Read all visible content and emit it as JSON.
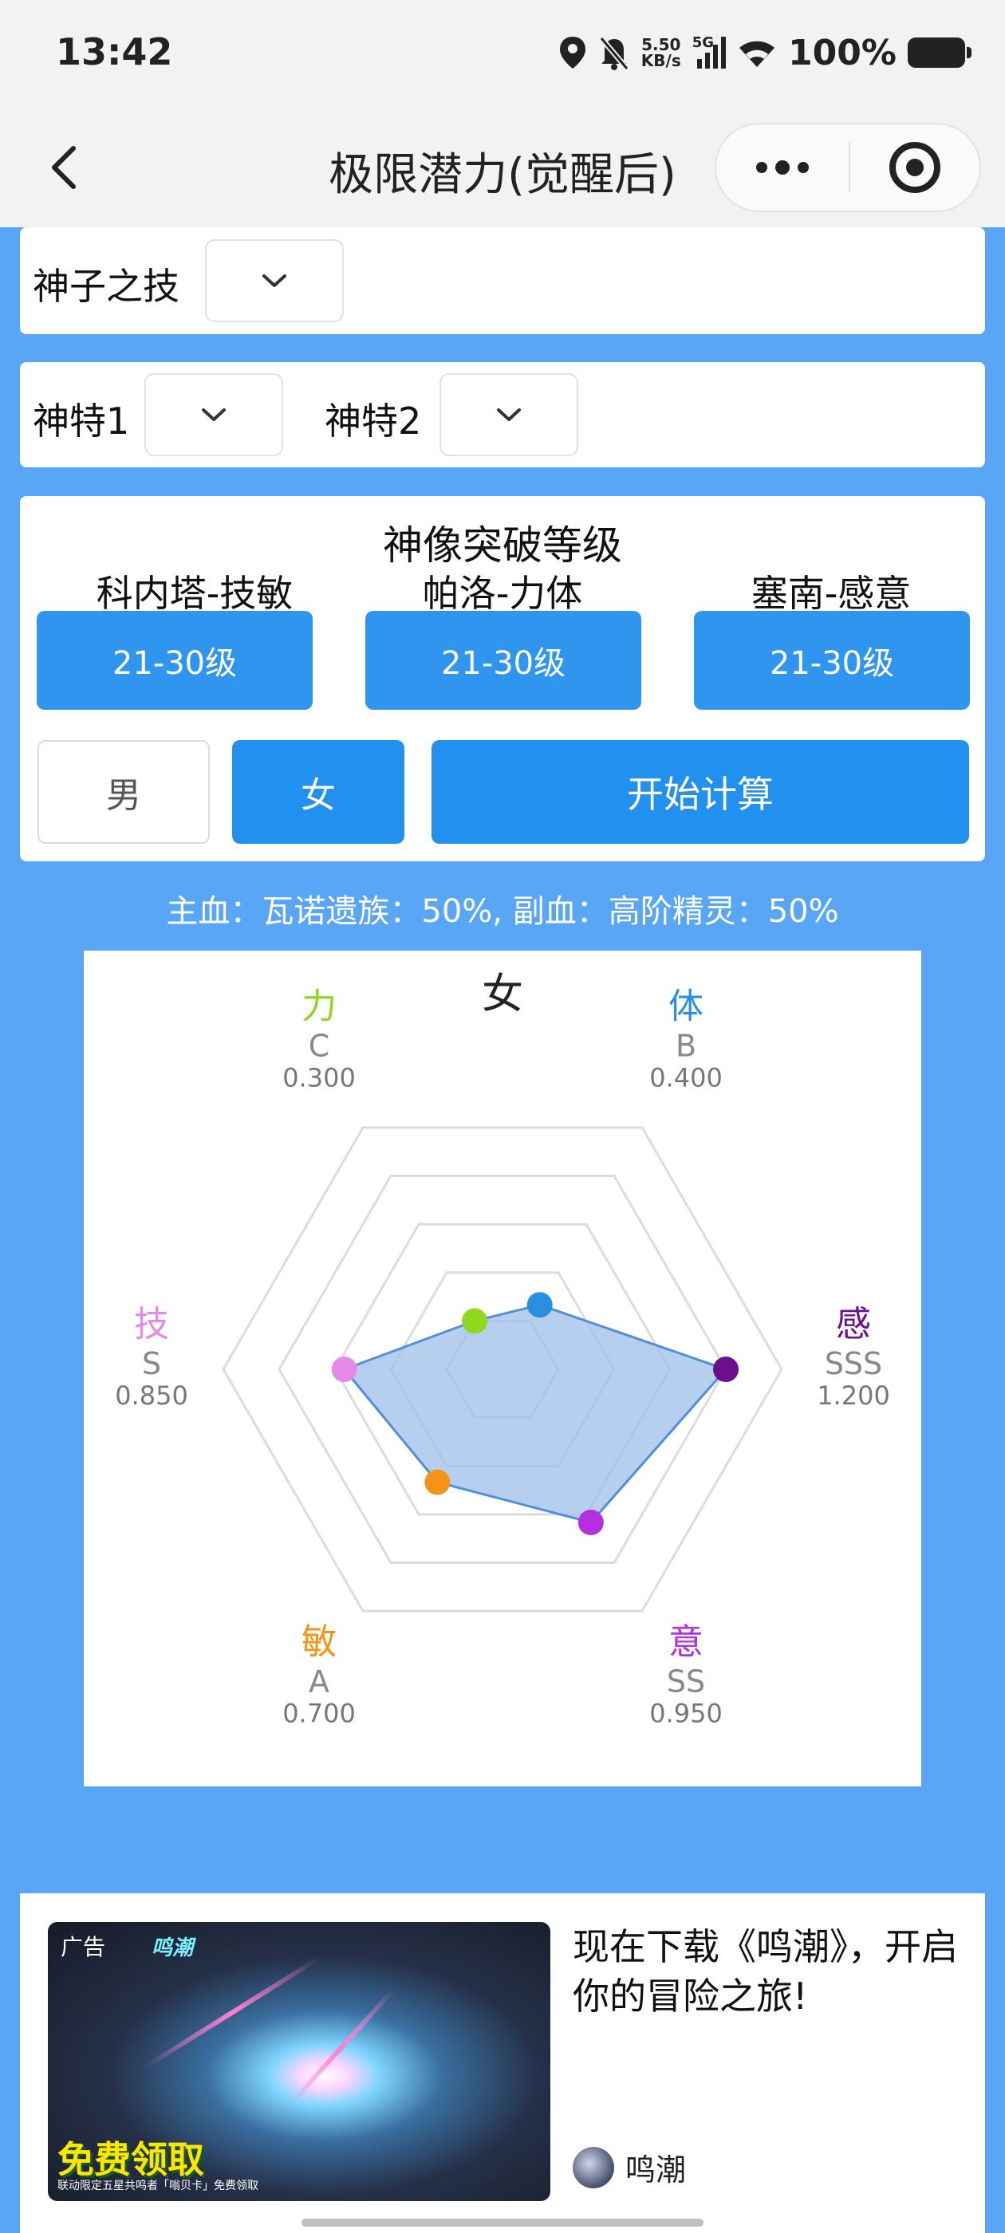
{
  "status": {
    "time": "13:42",
    "speed_value": "5.50",
    "speed_unit": "KB/s",
    "network": "5G",
    "battery": "100%",
    "icons": [
      "location-icon",
      "mute-icon",
      "signal-icon",
      "wifi-icon",
      "battery-icon"
    ]
  },
  "nav": {
    "title": "极限潜力(觉醒后)",
    "icons": [
      "back-icon",
      "more-icon",
      "target-icon"
    ]
  },
  "form": {
    "skill_label": "神子之技",
    "trait1_label": "神特1",
    "trait2_label": "神特2"
  },
  "breakthrough": {
    "title": "神像突破等级",
    "gods": [
      {
        "label": "科内塔-技敏",
        "level": "21-30级"
      },
      {
        "label": "帕洛-力体",
        "level": "21-30级"
      },
      {
        "label": "塞南-感意",
        "level": "21-30级"
      }
    ],
    "male_label": "男",
    "female_label": "女",
    "calculate_label": "开始计算",
    "selected_gender": "女"
  },
  "blood_line": "主血：瓦诺遗族：50%, 副血：高阶精灵：50%",
  "chart_data": {
    "type": "radar",
    "title": "女",
    "max": 1.5,
    "rings": 4,
    "axes": [
      {
        "name": "体",
        "grade": "B",
        "value": 0.4,
        "value_label": "0.400",
        "color": "#2a8fe0"
      },
      {
        "name": "感",
        "grade": "SSS",
        "value": 1.2,
        "value_label": "1.200",
        "color": "#6b0f8e"
      },
      {
        "name": "意",
        "grade": "SS",
        "value": 0.95,
        "value_label": "0.950",
        "color": "#b52fe0"
      },
      {
        "name": "敏",
        "grade": "A",
        "value": 0.7,
        "value_label": "0.700",
        "color": "#f39318"
      },
      {
        "name": "技",
        "grade": "S",
        "value": 0.85,
        "value_label": "0.850",
        "color": "#e58be5"
      },
      {
        "name": "力",
        "grade": "C",
        "value": 0.3,
        "value_label": "0.300",
        "color": "#8fd81d"
      }
    ],
    "fill_color": "#9fbfe8",
    "line_color": "#4f8fdc"
  },
  "ad": {
    "tag": "广告",
    "logo": "鸣潮",
    "promo": "免费领取",
    "promo_sub": "联动限定五星共鸣者「嗡贝卡」免费领取",
    "text": "现在下载《鸣潮》，开启你的冒险之旅!",
    "brand": "鸣潮"
  }
}
